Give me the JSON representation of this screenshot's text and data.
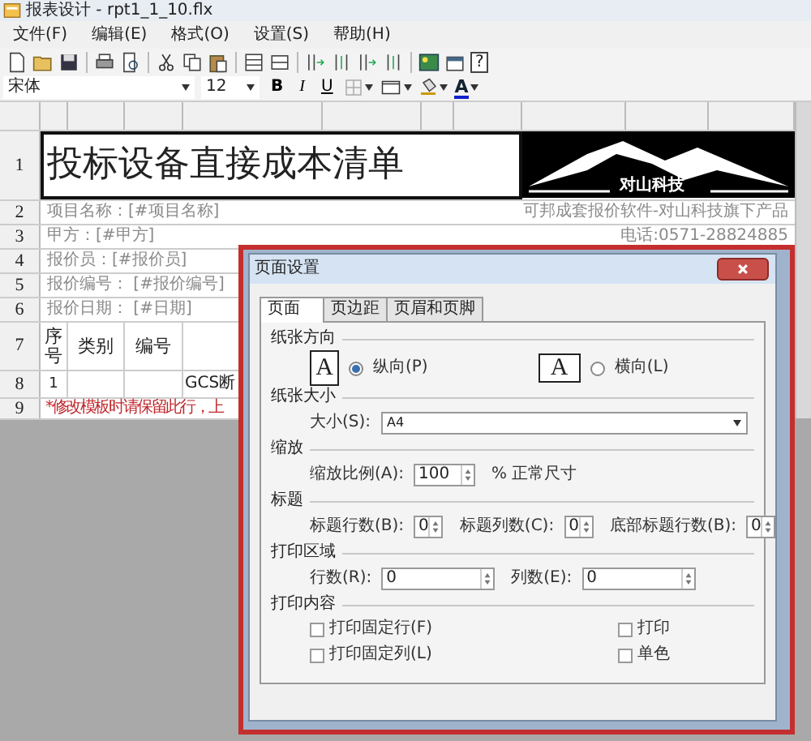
{
  "window": {
    "title": "报表设计 - rpt1_1_10.flx"
  },
  "menu": [
    "文件(F)",
    "编辑(E)",
    "格式(O)",
    "设置(S)",
    "帮助(H)"
  ],
  "toolbar": [
    {
      "kind": "new"
    },
    {
      "kind": "open"
    },
    {
      "kind": "save"
    },
    {
      "kind": "sep"
    },
    {
      "kind": "print"
    },
    {
      "kind": "preview"
    },
    {
      "kind": "sep"
    },
    {
      "kind": "cut"
    },
    {
      "kind": "copy"
    },
    {
      "kind": "paste"
    },
    {
      "kind": "sep"
    },
    {
      "kind": "insert_row"
    },
    {
      "kind": "delete_row"
    },
    {
      "kind": "sep"
    },
    {
      "kind": "insert_col"
    },
    {
      "kind": "split"
    },
    {
      "kind": "insert_col"
    },
    {
      "kind": "split"
    },
    {
      "kind": "sep"
    },
    {
      "kind": "image"
    },
    {
      "kind": "window"
    },
    {
      "kind": "help",
      "text": "?"
    }
  ],
  "format_bar": {
    "font": "宋体",
    "size": "12",
    "buttons": [
      {
        "kind": "bold",
        "text": "B"
      },
      {
        "kind": "italic",
        "text": "I"
      },
      {
        "kind": "underline",
        "text": "U"
      },
      {
        "kind": "borders"
      },
      {
        "kind": "frame"
      },
      {
        "kind": "fill"
      },
      {
        "kind": "font_color",
        "text": "A"
      }
    ]
  },
  "sheet": {
    "rows": [
      {
        "number": "1",
        "kind": "title",
        "text": "投标设备直接成本清单",
        "logo_text": "对山科技"
      },
      {
        "number": "2",
        "kind": "info",
        "text": "项目名称：[#项目名称]",
        "right_text": "可邦成套报价软件-对山科技旗下产品"
      },
      {
        "number": "3",
        "kind": "info",
        "text": "甲方：[#甲方]",
        "right_text": "电话:0571-28824885"
      },
      {
        "number": "4",
        "kind": "info",
        "text": "报价员：[#报价员]"
      },
      {
        "number": "5",
        "kind": "info",
        "text": "报价编号： [#报价编号]"
      },
      {
        "number": "6",
        "kind": "info",
        "text": "报价日期：  [#日期]"
      },
      {
        "number": "7",
        "kind": "header",
        "cells": [
          {
            "text": "序号"
          },
          {
            "text": "类别"
          },
          {
            "text": "编号"
          },
          {}
        ]
      },
      {
        "number": "8",
        "kind": "data",
        "cells": [
          {
            "text": "1"
          },
          {},
          {},
          {
            "text": "GCS断"
          }
        ]
      },
      {
        "number": "9",
        "kind": "note",
        "text": "*修改模板时请保留此行，上"
      }
    ]
  },
  "dialog": {
    "title": "页面设置",
    "tabs": [
      {
        "label": "页面",
        "selected": true
      },
      {
        "label": "页边距",
        "selected": false
      },
      {
        "label": "页眉和页脚",
        "selected": false
      }
    ],
    "sections": [
      {
        "title": "纸张方向",
        "rows": [
          [
            {
              "kind": "radio",
              "landscape": false,
              "icon_text": "A",
              "label": "纵向(P)",
              "selected": true
            },
            {
              "kind": "radio",
              "landscape": true,
              "icon_text": "A",
              "label": "横向(L)",
              "selected": false
            }
          ]
        ]
      },
      {
        "title": "纸张大小",
        "rows": [
          [
            {
              "kind": "select",
              "label": "大小(S):",
              "value": "A4"
            }
          ]
        ]
      },
      {
        "title": "缩放",
        "rows": [
          [
            {
              "kind": "spinner",
              "label": "缩放比例(A):",
              "value": "100",
              "suffix": "% 正常尺寸"
            }
          ]
        ]
      },
      {
        "title": "标题",
        "rows": [
          [
            {
              "kind": "spinner",
              "label": "标题行数(B):",
              "value": "0"
            },
            {
              "kind": "spinner",
              "label": "标题列数(C):",
              "value": "0"
            },
            {
              "kind": "spinner",
              "label": "底部标题行数(B):",
              "value": "0"
            }
          ]
        ]
      },
      {
        "title": "打印区域",
        "rows": [
          [
            {
              "kind": "spinner",
              "label": "行数(R):",
              "value": "0"
            },
            {
              "kind": "spinner",
              "label": "列数(E):",
              "value": "0"
            }
          ]
        ]
      },
      {
        "title": "打印内容",
        "rows": [
          [
            {
              "kind": "checkbox",
              "label": "打印固定行(F)",
              "checked": false
            },
            {
              "kind": "checkbox",
              "label": "打印",
              "checked": false
            }
          ],
          [
            {
              "kind": "checkbox",
              "label": "打印固定列(L)",
              "checked": false
            },
            {
              "kind": "checkbox",
              "label": "单色",
              "checked": false
            }
          ]
        ]
      }
    ]
  }
}
